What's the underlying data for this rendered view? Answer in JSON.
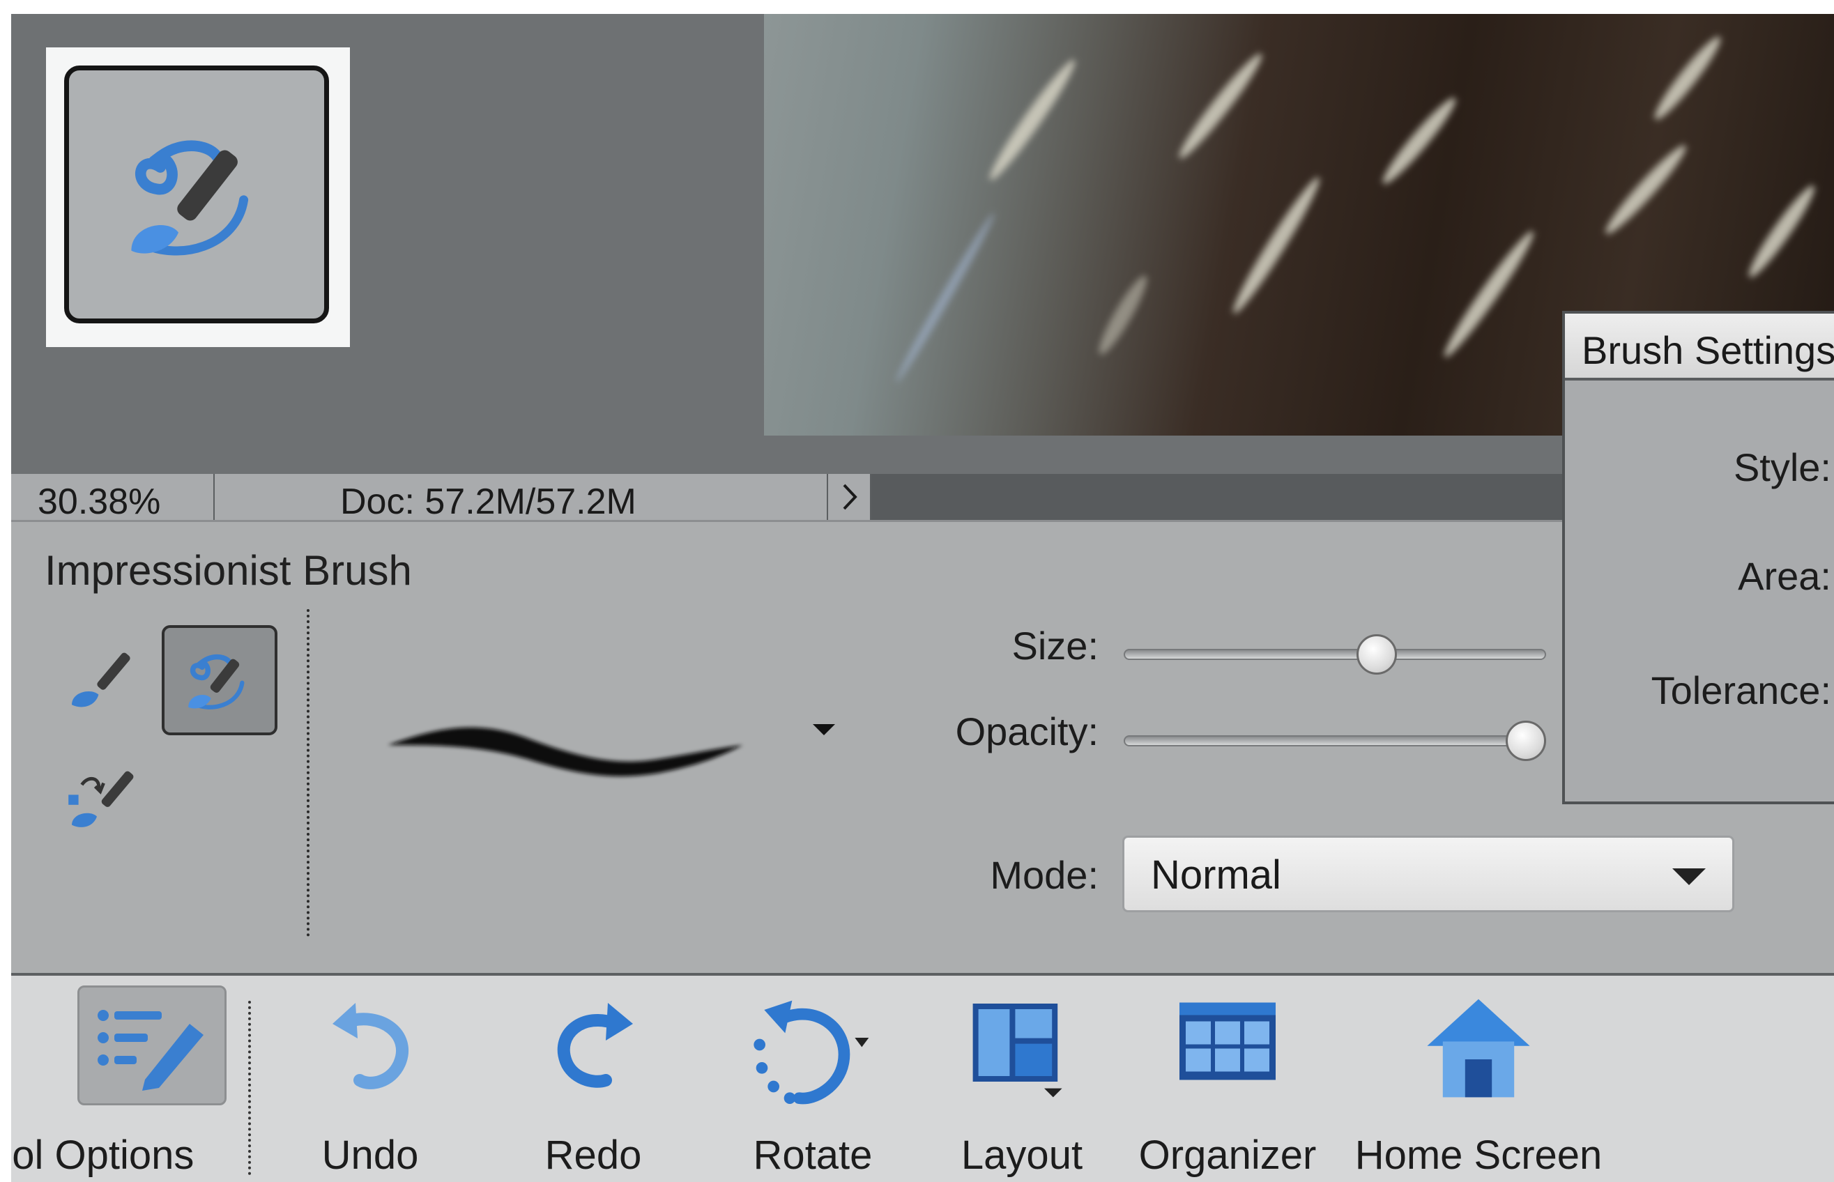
{
  "status_bar": {
    "zoom": "30.38%",
    "doc_info": "Doc: 57.2M/57.2M",
    "expand_icon": "chevron-right"
  },
  "tool_options": {
    "title": "Impressionist Brush",
    "tools": [
      {
        "name": "clone-brush",
        "icon": "brush-icon",
        "selected": false
      },
      {
        "name": "impressionist-brush",
        "icon": "impressionist-brush-icon",
        "selected": true
      },
      {
        "name": "color-replacement-brush",
        "icon": "color-replace-brush-icon",
        "selected": false
      }
    ],
    "size_label": "Size:",
    "size_value": 0.61,
    "opacity_label": "Opacity:",
    "opacity_value": 1.0,
    "mode_label": "Mode:",
    "mode_value": "Normal"
  },
  "brush_settings": {
    "title": "Brush Settings",
    "style_label": "Style:",
    "area_label": "Area:",
    "tolerance_label": "Tolerance:"
  },
  "taskbar": {
    "tool_options": "Tool Options",
    "undo": "Undo",
    "redo": "Redo",
    "rotate": "Rotate",
    "layout": "Layout",
    "organizer": "Organizer",
    "home_screen": "Home Screen"
  },
  "colors": {
    "accent_blue": "#3a7fd0",
    "panel_gray": "#acaeaf",
    "taskbar_gray": "#d6d7d8"
  }
}
